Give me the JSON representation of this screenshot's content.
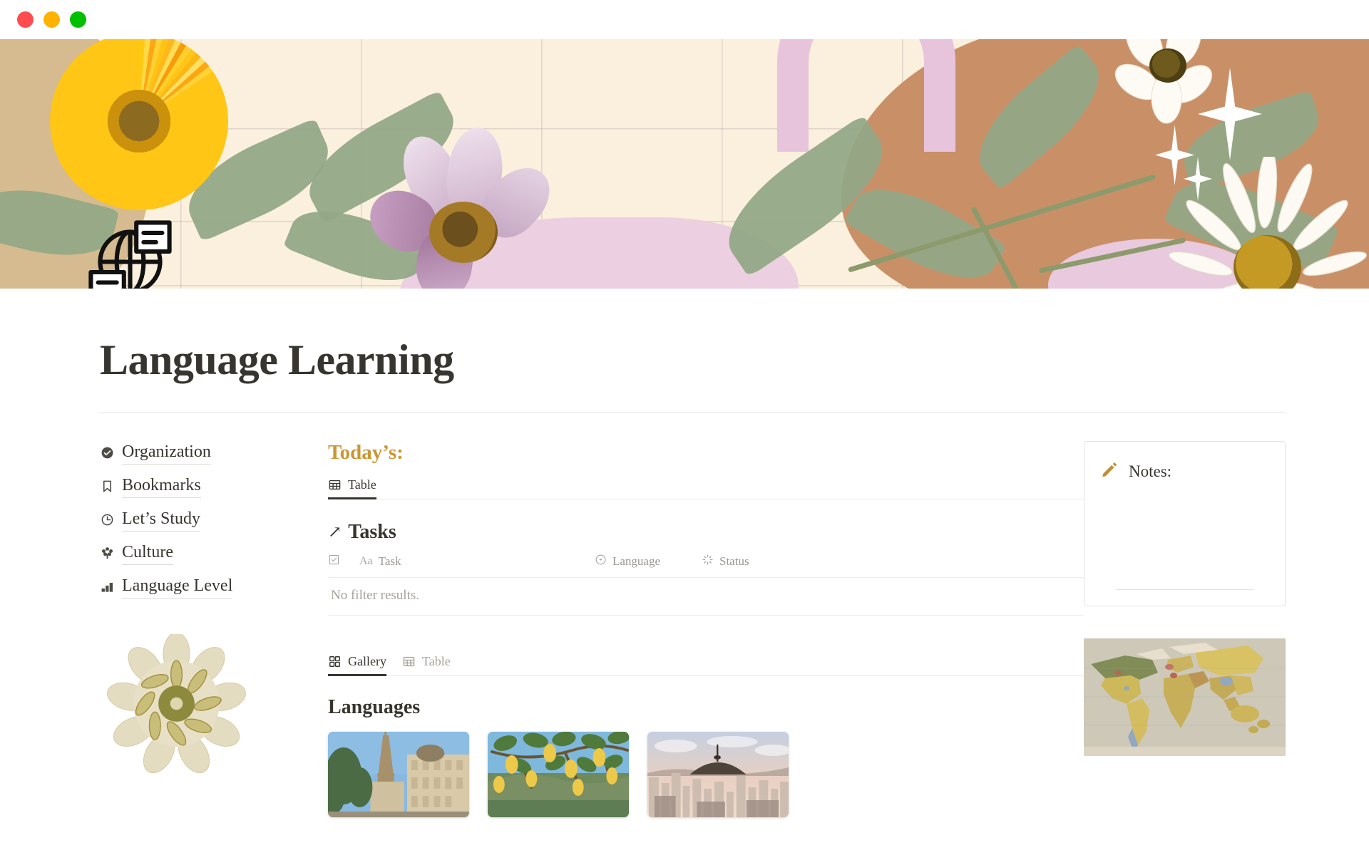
{
  "window": {
    "controls": [
      {
        "name": "close",
        "color": "#ff4d4f"
      },
      {
        "name": "minimize",
        "color": "#ffb300"
      },
      {
        "name": "maximize",
        "color": "#00c000"
      }
    ]
  },
  "banner": {
    "colors": {
      "background": "#faf0dd",
      "terracotta": "#c99068",
      "tan": "#d5bb8f",
      "pink": "#e8c4dc",
      "sage": "#93a887",
      "stem": "#8c9a6c",
      "grid_line": "#aa96a5"
    },
    "icon_name": "globe-translate-icon"
  },
  "page": {
    "title": "Language Learning",
    "icon": "globe-translate-icon"
  },
  "sidebar": {
    "items": [
      {
        "label": "Organization",
        "icon": "check-circle-icon"
      },
      {
        "label": "Bookmarks",
        "icon": "bookmark-icon"
      },
      {
        "label": "Let’s Study",
        "icon": "clock-icon"
      },
      {
        "label": "Culture",
        "icon": "flower-icon"
      },
      {
        "label": "Language Level",
        "icon": "bar-chart-icon"
      }
    ],
    "decoration": "pressed-flower-image"
  },
  "main": {
    "today_heading": "Today’s:",
    "today_heading_color": "#cb9633",
    "today_tabs": [
      {
        "label": "Table",
        "icon": "table-icon",
        "active": true
      }
    ],
    "tasks_database": {
      "title": "Tasks",
      "link_icon": "arrow-up-right-icon",
      "columns": [
        {
          "label": "",
          "icon": "checkbox-icon"
        },
        {
          "label": "Task",
          "icon": "aa-text-icon"
        },
        {
          "label": "Language",
          "icon": "select-circle-icon"
        },
        {
          "label": "Status",
          "icon": "status-spinner-icon"
        }
      ],
      "empty_message": "No filter results."
    },
    "gallery_tabs": [
      {
        "label": "Gallery",
        "icon": "gallery-grid-icon",
        "active": true
      },
      {
        "label": "Table",
        "icon": "table-icon",
        "active": false
      }
    ],
    "gallery_database": {
      "title": "Languages",
      "cards": [
        {
          "name": "eiffel-tower-paris-card"
        },
        {
          "name": "lemon-tree-coast-card"
        },
        {
          "name": "seoul-skyline-card"
        }
      ]
    }
  },
  "right_panel": {
    "notes": {
      "title": "Notes:",
      "icon": "pencil-icon",
      "icon_color": "#c28f35"
    },
    "map_image": "vintage-world-map-image"
  }
}
